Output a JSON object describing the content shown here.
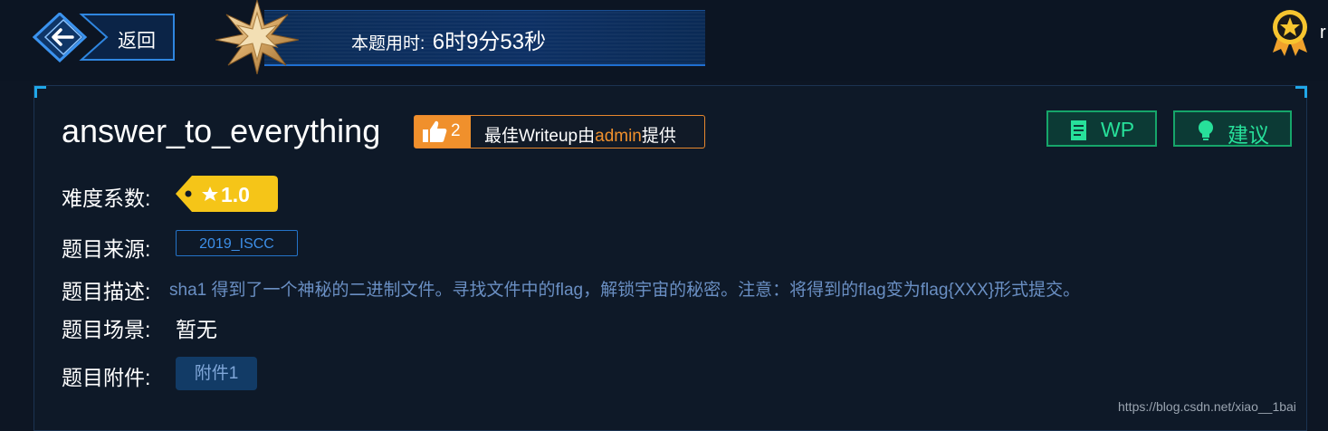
{
  "header": {
    "back_label": "返回",
    "timer_label": "本题用时:",
    "timer_value": "6时9分53秒",
    "user_fragment": "r"
  },
  "challenge": {
    "title": "answer_to_everything",
    "likes": "2",
    "writeup_prefix": "最佳Writeup由",
    "writeup_author": "admin",
    "writeup_suffix": "提供",
    "wp_button": "WP",
    "suggest_button": "建议"
  },
  "fields": {
    "difficulty_label": "难度系数:",
    "difficulty_value": "1.0",
    "source_label": "题目来源:",
    "source_value": "2019_ISCC",
    "description_label": "题目描述:",
    "description_value": "sha1 得到了一个神秘的二进制文件。寻找文件中的flag，解锁宇宙的秘密。注意：将得到的flag变为flag{XXX}形式提交。",
    "scene_label": "题目场景:",
    "scene_value": "暂无",
    "attachment_label": "题目附件:",
    "attachment_value": "附件1"
  },
  "watermark": "https://blog.csdn.net/xiao__1bai",
  "colors": {
    "background": "#0d1624",
    "accent_orange": "#f0902c",
    "accent_green": "#27e09a",
    "accent_blue": "#3d8fe8",
    "difficulty_yellow": "#f5c518"
  },
  "icons": [
    "back-arrow-icon",
    "star-badge-icon",
    "medal-icon",
    "thumbs-up-icon",
    "document-icon",
    "lightbulb-icon",
    "star-icon"
  ]
}
